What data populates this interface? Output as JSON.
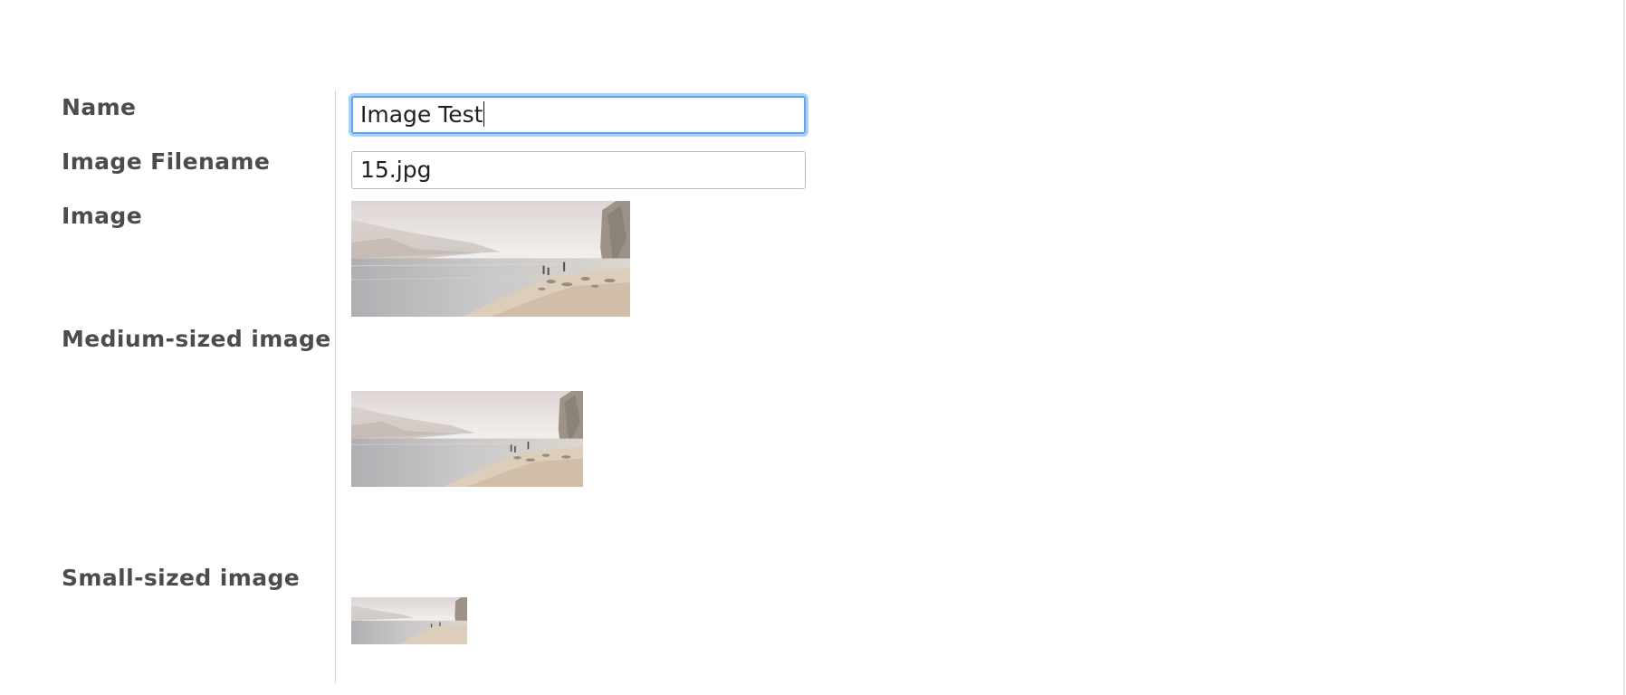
{
  "form": {
    "fields": {
      "name": {
        "label": "Name",
        "value": "Image Test",
        "focused": true
      },
      "filename": {
        "label": "Image Filename",
        "value": "15.jpg"
      },
      "image": {
        "label": "Image"
      },
      "medium_image": {
        "label": "Medium-sized image"
      },
      "small_image": {
        "label": "Small-sized image"
      }
    }
  },
  "colors": {
    "focus_ring": "#5ea8ef",
    "label_text": "#4c4c4c",
    "field_border": "#b9b9b9"
  }
}
